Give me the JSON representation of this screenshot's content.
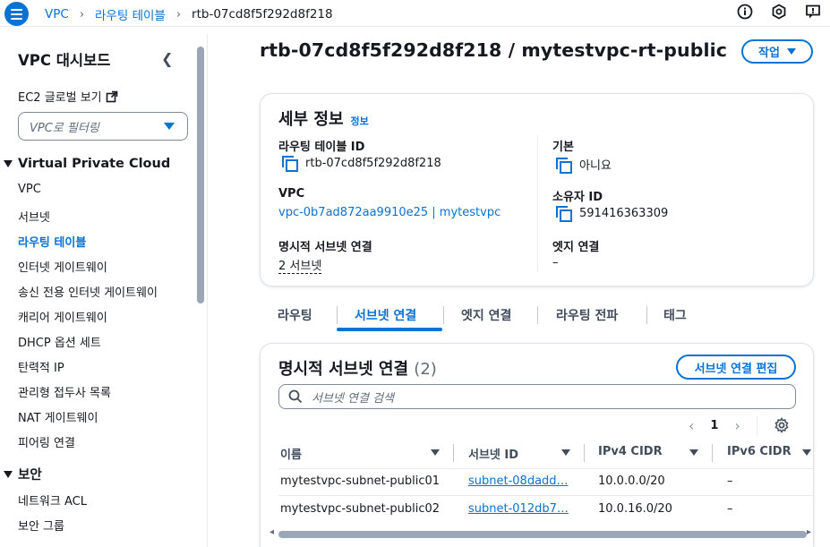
{
  "breadcrumbs": [
    {
      "label": "VPC"
    },
    {
      "label": "라우팅 테이블"
    },
    {
      "label": "rtb-07cd8f5f292d8f218"
    }
  ],
  "top_icons": [
    "info-icon",
    "settings-hex-icon",
    "feedback-icon"
  ],
  "sidebar": {
    "title": "VPC 대시보드",
    "ec2_link": "EC2 글로벌 보기",
    "filter_placeholder": "VPC로 필터링",
    "section_vpc": "Virtual Private Cloud",
    "items": [
      {
        "label": "VPC"
      },
      {
        "label": "서브넷"
      },
      {
        "label": "라우팅 테이블",
        "active": true
      },
      {
        "label": "인터넷 게이트웨이"
      },
      {
        "label": "송신 전용 인터넷 게이트웨이"
      },
      {
        "label": "캐리어 게이트웨이"
      },
      {
        "label": "DHCP 옵션 세트"
      },
      {
        "label": "탄력적 IP"
      },
      {
        "label": "관리형 접두사 목록"
      },
      {
        "label": "NAT 게이트웨이"
      },
      {
        "label": "피어링 연결"
      }
    ],
    "section_security": "보안",
    "security_items": [
      {
        "label": "네트워크 ACL"
      },
      {
        "label": "보안 그룹"
      }
    ]
  },
  "page": {
    "title": "rtb-07cd8f5f292d8f218 / mytestvpc-rt-public",
    "action_button": "작업"
  },
  "details": {
    "heading": "세부 정보",
    "info_link": "정보",
    "route_table_id_label": "라우팅 테이블 ID",
    "route_table_id": "rtb-07cd8f5f292d8f218",
    "main_label": "기본",
    "main_value": "아니요",
    "vpc_label": "VPC",
    "vpc_value": "vpc-0b7ad872aa9910e25 | mytestvpc",
    "owner_label": "소유자 ID",
    "owner_value": "591416363309",
    "explicit_label": "명시적 서브넷 연결",
    "explicit_value": "2 서브넷",
    "edge_label": "엣지 연결",
    "edge_value": "–"
  },
  "tabs": [
    {
      "label": "라우팅"
    },
    {
      "label": "서브넷 연결",
      "active": true
    },
    {
      "label": "엣지 연결"
    },
    {
      "label": "라우팅 전파"
    },
    {
      "label": "태그"
    }
  ],
  "associations": {
    "heading": "명시적 서브넷 연결",
    "count": "(2)",
    "edit_button": "서브넷 연결 편집",
    "search_placeholder": "서브넷 연결 검색",
    "page_number": "1",
    "columns": [
      "이름",
      "서브넷 ID",
      "IPv4 CIDR",
      "IPv6 CIDR"
    ],
    "rows": [
      {
        "name": "mytestvpc-subnet-public01",
        "subnet_id": "subnet-08dadd…",
        "ipv4": "10.0.0.0/20",
        "ipv6": "–"
      },
      {
        "name": "mytestvpc-subnet-public02",
        "subnet_id": "subnet-012db7…",
        "ipv4": "10.0.16.0/20",
        "ipv6": "–"
      }
    ]
  },
  "colors": {
    "accent": "#0972d3",
    "text": "#16191f",
    "muted": "#5f6b7a"
  }
}
